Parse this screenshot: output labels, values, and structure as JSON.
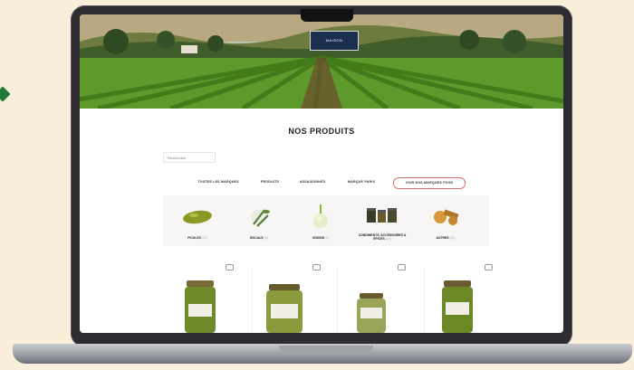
{
  "site": {
    "logo_text": "MAISON",
    "section_title": "NOS PRODUITS",
    "search_placeholder": "Rechercher"
  },
  "filters": [
    {
      "label": "TOUTES LES MARQUES",
      "active": false
    },
    {
      "label": "PRODUITS",
      "active": false
    },
    {
      "label": "ASSAISONNÉS",
      "active": false
    },
    {
      "label": "MARQUE PARIS",
      "active": false
    },
    {
      "label": "VOIR NOS MARQUES FOOD",
      "active": true
    }
  ],
  "categories": [
    {
      "label": "PICKLES",
      "count": "(12)",
      "icon": "pickle-icon"
    },
    {
      "label": "BOCAUX",
      "count": "(8)",
      "icon": "herbs-icon"
    },
    {
      "label": "ONIONS",
      "count": "(6)",
      "icon": "onion-icon"
    },
    {
      "label": "CONDIMENTS, ACCESSOIRES & ÉPICES",
      "count": "(14)",
      "icon": "jars-icon"
    },
    {
      "label": "AUTRES",
      "count": "(10)",
      "icon": "spices-icon"
    }
  ],
  "products": [
    {
      "name": "pickle-jar-1",
      "color": "#6f8a2a"
    },
    {
      "name": "pickle-jar-2",
      "color": "#8b9a3c"
    },
    {
      "name": "pickle-jar-3",
      "color": "#9aa55a"
    },
    {
      "name": "pickle-jar-4",
      "color": "#6b8a26"
    }
  ],
  "colors": {
    "accent": "#d6726b",
    "field_green": "#4f8424",
    "background": "#f8eed9"
  }
}
